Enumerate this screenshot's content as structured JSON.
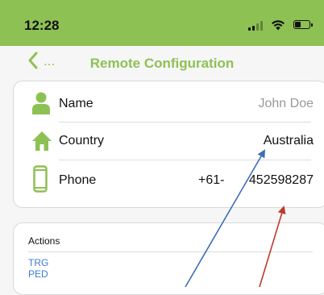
{
  "status_bar": {
    "time": "12:28"
  },
  "nav": {
    "back_label": "...",
    "title": "Remote Configuration"
  },
  "contact": {
    "name_label": "Name",
    "name_value": "John Doe",
    "country_label": "Country",
    "country_value": "Australia",
    "phone_label": "Phone",
    "phone_prefix": "+61-",
    "phone_number": "452598287"
  },
  "actions": {
    "title": "Actions",
    "items": [
      "TRG",
      "PED"
    ]
  },
  "colors": {
    "brand": "#8dc154",
    "link": "#3a7bd5",
    "arrow_blue": "#3d6fb5",
    "arrow_red": "#c0392b"
  }
}
